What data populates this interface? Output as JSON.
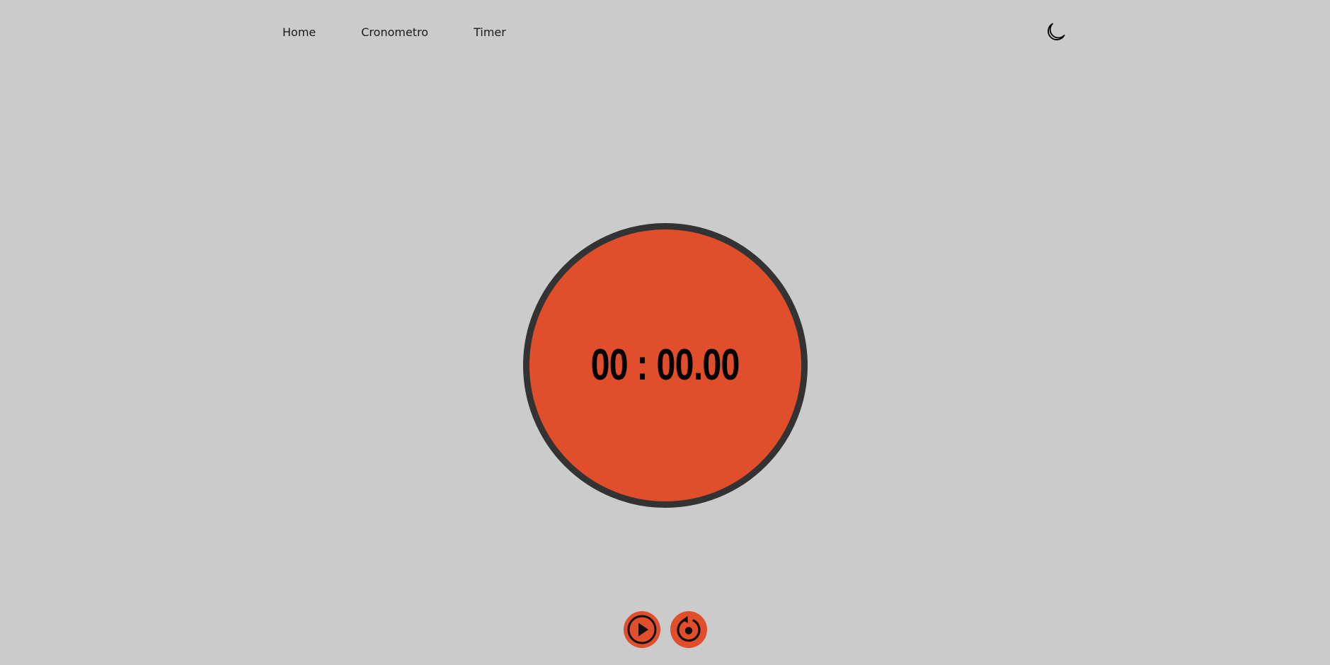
{
  "nav": {
    "items": [
      {
        "label": "Home"
      },
      {
        "label": "Cronometro"
      },
      {
        "label": "Timer"
      }
    ]
  },
  "theme_toggle": {
    "icon": "moon-icon"
  },
  "stopwatch": {
    "display": "00 : 00.00"
  },
  "controls": {
    "play_icon": "play-icon",
    "reset_icon": "reset-icon"
  },
  "colors": {
    "background": "#cbcbcb",
    "accent": "#e04e2c",
    "ring": "#333333",
    "text": "#000000"
  }
}
